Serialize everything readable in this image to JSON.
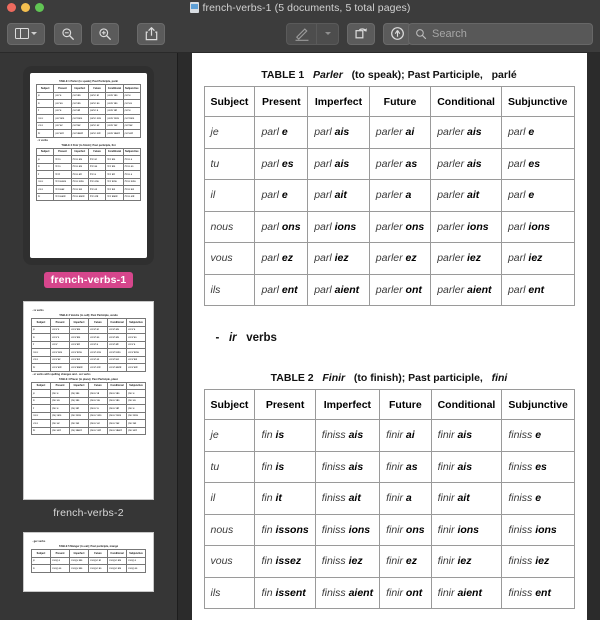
{
  "window": {
    "title": "french-verbs-1 (5 documents, 5 total pages)",
    "doc_icon": "document-icon",
    "traffic_lights": {
      "close": "#ed6a5e",
      "minimize": "#f4bf4f",
      "maximize": "#61c554"
    }
  },
  "toolbar": {
    "sidebar_toggle": "sidebar-toggle-icon",
    "sidebar_chevron": "chevron-down-icon",
    "zoom_out": "zoom-out-icon",
    "zoom_in": "zoom-in-icon",
    "share": "share-icon",
    "markup": "markup-pen-icon",
    "markup_chevron": "chevron-down-icon",
    "rotate": "rotate-icon",
    "redact": "redact-icon",
    "search_icon": "search-icon",
    "search_placeholder": "Search",
    "search_value": ""
  },
  "sidebar": {
    "thumbnails": [
      {
        "label": "french-verbs-1",
        "selected": true
      },
      {
        "label": "french-verbs-2",
        "selected": false
      },
      {
        "label": "french-verbs-3",
        "selected": false
      }
    ]
  },
  "main": {
    "table1": {
      "caption_prefix": "TABLE 1",
      "caption_verb": "Parler",
      "caption_rest": "(to speak); Past Participle,",
      "caption_participle": "parlé"
    },
    "section_ir": {
      "dash": "-",
      "verb": "ir",
      "word": "verbs"
    },
    "table2": {
      "caption_prefix": "TABLE 2",
      "caption_verb": "Finir",
      "caption_rest": "(to finish); Past participle,",
      "caption_participle": "fini"
    },
    "columns": [
      "Subject",
      "Present",
      "Imperfect",
      "Future",
      "Conditional",
      "Subjunctive"
    ],
    "subjects": [
      "je",
      "tu",
      "il",
      "nous",
      "vous",
      "ils"
    ],
    "table1_rows": [
      {
        "subject": "je",
        "present": [
          "parl",
          "e"
        ],
        "imperfect": [
          "parl",
          "ais"
        ],
        "future": [
          "parler",
          "ai"
        ],
        "conditional": [
          "parler",
          "ais"
        ],
        "subjunctive": [
          "parl",
          "e"
        ]
      },
      {
        "subject": "tu",
        "present": [
          "parl",
          "es"
        ],
        "imperfect": [
          "parl",
          "ais"
        ],
        "future": [
          "parler",
          "as"
        ],
        "conditional": [
          "parler",
          "ais"
        ],
        "subjunctive": [
          "parl",
          "es"
        ]
      },
      {
        "subject": "il",
        "present": [
          "parl",
          "e"
        ],
        "imperfect": [
          "parl",
          "ait"
        ],
        "future": [
          "parler",
          "a"
        ],
        "conditional": [
          "parler",
          "ait"
        ],
        "subjunctive": [
          "parl",
          "e"
        ]
      },
      {
        "subject": "nous",
        "present": [
          "parl",
          "ons"
        ],
        "imperfect": [
          "parl",
          "ions"
        ],
        "future": [
          "parler",
          "ons"
        ],
        "conditional": [
          "parler",
          "ions"
        ],
        "subjunctive": [
          "parl",
          "ions"
        ]
      },
      {
        "subject": "vous",
        "present": [
          "parl",
          "ez"
        ],
        "imperfect": [
          "parl",
          "iez"
        ],
        "future": [
          "parler",
          "ez"
        ],
        "conditional": [
          "parler",
          "iez"
        ],
        "subjunctive": [
          "parl",
          "iez"
        ]
      },
      {
        "subject": "ils",
        "present": [
          "parl",
          "ent"
        ],
        "imperfect": [
          "parl",
          "aient"
        ],
        "future": [
          "parler",
          "ont"
        ],
        "conditional": [
          "parler",
          "aient"
        ],
        "subjunctive": [
          "parl",
          "ent"
        ]
      }
    ],
    "table2_rows": [
      {
        "subject": "je",
        "present": [
          "fin",
          "is"
        ],
        "imperfect": [
          "finiss",
          "ais"
        ],
        "future": [
          "finir",
          "ai"
        ],
        "conditional": [
          "finir",
          "ais"
        ],
        "subjunctive": [
          "finiss",
          "e"
        ]
      },
      {
        "subject": "tu",
        "present": [
          "fin",
          "is"
        ],
        "imperfect": [
          "finiss",
          "ais"
        ],
        "future": [
          "finir",
          "as"
        ],
        "conditional": [
          "finir",
          "ais"
        ],
        "subjunctive": [
          "finiss",
          "es"
        ]
      },
      {
        "subject": "il",
        "present": [
          "fin",
          "it"
        ],
        "imperfect": [
          "finiss",
          "ait"
        ],
        "future": [
          "finir",
          "a"
        ],
        "conditional": [
          "finir",
          "ait"
        ],
        "subjunctive": [
          "finiss",
          "e"
        ]
      },
      {
        "subject": "nous",
        "present": [
          "fin",
          "issons"
        ],
        "imperfect": [
          "finiss",
          "ions"
        ],
        "future": [
          "finir",
          "ons"
        ],
        "conditional": [
          "finir",
          "ions"
        ],
        "subjunctive": [
          "finiss",
          "ions"
        ]
      },
      {
        "subject": "vous",
        "present": [
          "fin",
          "issez"
        ],
        "imperfect": [
          "finiss",
          "iez"
        ],
        "future": [
          "finir",
          "ez"
        ],
        "conditional": [
          "finir",
          "iez"
        ],
        "subjunctive": [
          "finiss",
          "iez"
        ]
      },
      {
        "subject": "ils",
        "present": [
          "fin",
          "issent"
        ],
        "imperfect": [
          "finiss",
          "aient"
        ],
        "future": [
          "finir",
          "ont"
        ],
        "conditional": [
          "finir",
          "aient"
        ],
        "subjunctive": [
          "finiss",
          "ent"
        ]
      }
    ]
  },
  "thumbnail_pages": [
    {
      "blocks": [
        {
          "kind": "table",
          "title": "TABLE 1  Parler (to speak); Past Participle, parlé",
          "rows": [
            [
              "je",
              "parl|e",
              "parl|ais",
              "parler|ai",
              "parler|ais",
              "parl|e"
            ],
            [
              "tu",
              "parl|es",
              "parl|ais",
              "parler|as",
              "parler|ais",
              "parl|es"
            ],
            [
              "il",
              "parl|e",
              "parl|ait",
              "parler|a",
              "parler|ait",
              "parl|e"
            ],
            [
              "nous",
              "parl|ons",
              "parl|ions",
              "parler|ons",
              "parler|ions",
              "parl|ions"
            ],
            [
              "vous",
              "parl|ez",
              "parl|iez",
              "parler|ez",
              "parler|iez",
              "parl|iez"
            ],
            [
              "ils",
              "parl|ent",
              "parl|aient",
              "parler|ont",
              "parler|aient",
              "parl|ent"
            ]
          ]
        },
        {
          "kind": "heading",
          "text": "- ir verbs"
        },
        {
          "kind": "table",
          "title": "TABLE 2  Finir (to finish); Past participle, fini",
          "rows": [
            [
              "je",
              "fin|is",
              "finiss|ais",
              "finir|ai",
              "finir|ais",
              "finiss|e"
            ],
            [
              "tu",
              "fin|is",
              "finiss|ais",
              "finir|as",
              "finir|ais",
              "finiss|es"
            ],
            [
              "il",
              "fin|it",
              "finiss|ait",
              "finir|a",
              "finir|ait",
              "finiss|e"
            ],
            [
              "nous",
              "fin|issons",
              "finiss|ions",
              "finir|ons",
              "finir|ions",
              "finiss|ions"
            ],
            [
              "vous",
              "fin|issez",
              "finiss|iez",
              "finir|ez",
              "finir|iez",
              "finiss|iez"
            ],
            [
              "ils",
              "fin|issent",
              "finiss|aient",
              "finir|ont",
              "finir|aient",
              "finiss|ent"
            ]
          ]
        }
      ]
    },
    {
      "blocks": [
        {
          "kind": "heading",
          "text": "- re verbs"
        },
        {
          "kind": "table",
          "title": "TABLE 3  Vendre (to sell); Past Participle, vendu",
          "rows": [
            [
              "je",
              "vend|s",
              "vend|ais",
              "vendr|ai",
              "vendr|ais",
              "vend|e"
            ],
            [
              "tu",
              "vend|s",
              "vend|ais",
              "vendr|as",
              "vendr|ais",
              "vend|es"
            ],
            [
              "il",
              "vend|",
              "vend|ait",
              "vendr|a",
              "vendr|ait",
              "vend|e"
            ],
            [
              "nous",
              "vend|ons",
              "vend|ions",
              "vendr|ons",
              "vendr|ions",
              "vend|ions"
            ],
            [
              "vous",
              "vend|ez",
              "vend|iez",
              "vendr|ez",
              "vendr|iez",
              "vend|iez"
            ],
            [
              "ils",
              "vend|ent",
              "vend|aient",
              "vendr|ont",
              "vendr|aient",
              "vend|ent"
            ]
          ]
        },
        {
          "kind": "heading",
          "text": "- er verbs with spelling changes and - cer verbs"
        },
        {
          "kind": "table",
          "title": "TABLE 4  Placer (to place); Past Participle, placé",
          "rows": [
            [
              "je",
              "plac|e",
              "plaç|ais",
              "placer|ai",
              "placer|ais",
              "plac|e"
            ],
            [
              "tu",
              "plac|es",
              "plaç|ais",
              "placer|as",
              "placer|ais",
              "plac|es"
            ],
            [
              "il",
              "plac|e",
              "plaç|ait",
              "placer|a",
              "placer|ait",
              "plac|e"
            ],
            [
              "nous",
              "plaç|ons",
              "plac|ions",
              "placer|ons",
              "placer|ions",
              "plac|ions"
            ],
            [
              "vous",
              "plac|ez",
              "plac|iez",
              "placer|ez",
              "placer|iez",
              "plac|iez"
            ],
            [
              "ils",
              "plac|ent",
              "plaç|aient",
              "placer|ont",
              "placer|aient",
              "plac|ent"
            ]
          ]
        }
      ]
    },
    {
      "blocks": [
        {
          "kind": "heading",
          "text": "- ger verbs"
        },
        {
          "kind": "table",
          "title": "TABLE 5  Manger (to eat); Past participle, mangé",
          "rows": [
            [
              "je",
              "mang|e",
              "mange|ais",
              "manger|ai",
              "manger|ais",
              "mang|e"
            ],
            [
              "tu",
              "mang|es",
              "mange|ais",
              "manger|as",
              "manger|ais",
              "mang|es"
            ]
          ]
        }
      ]
    }
  ]
}
